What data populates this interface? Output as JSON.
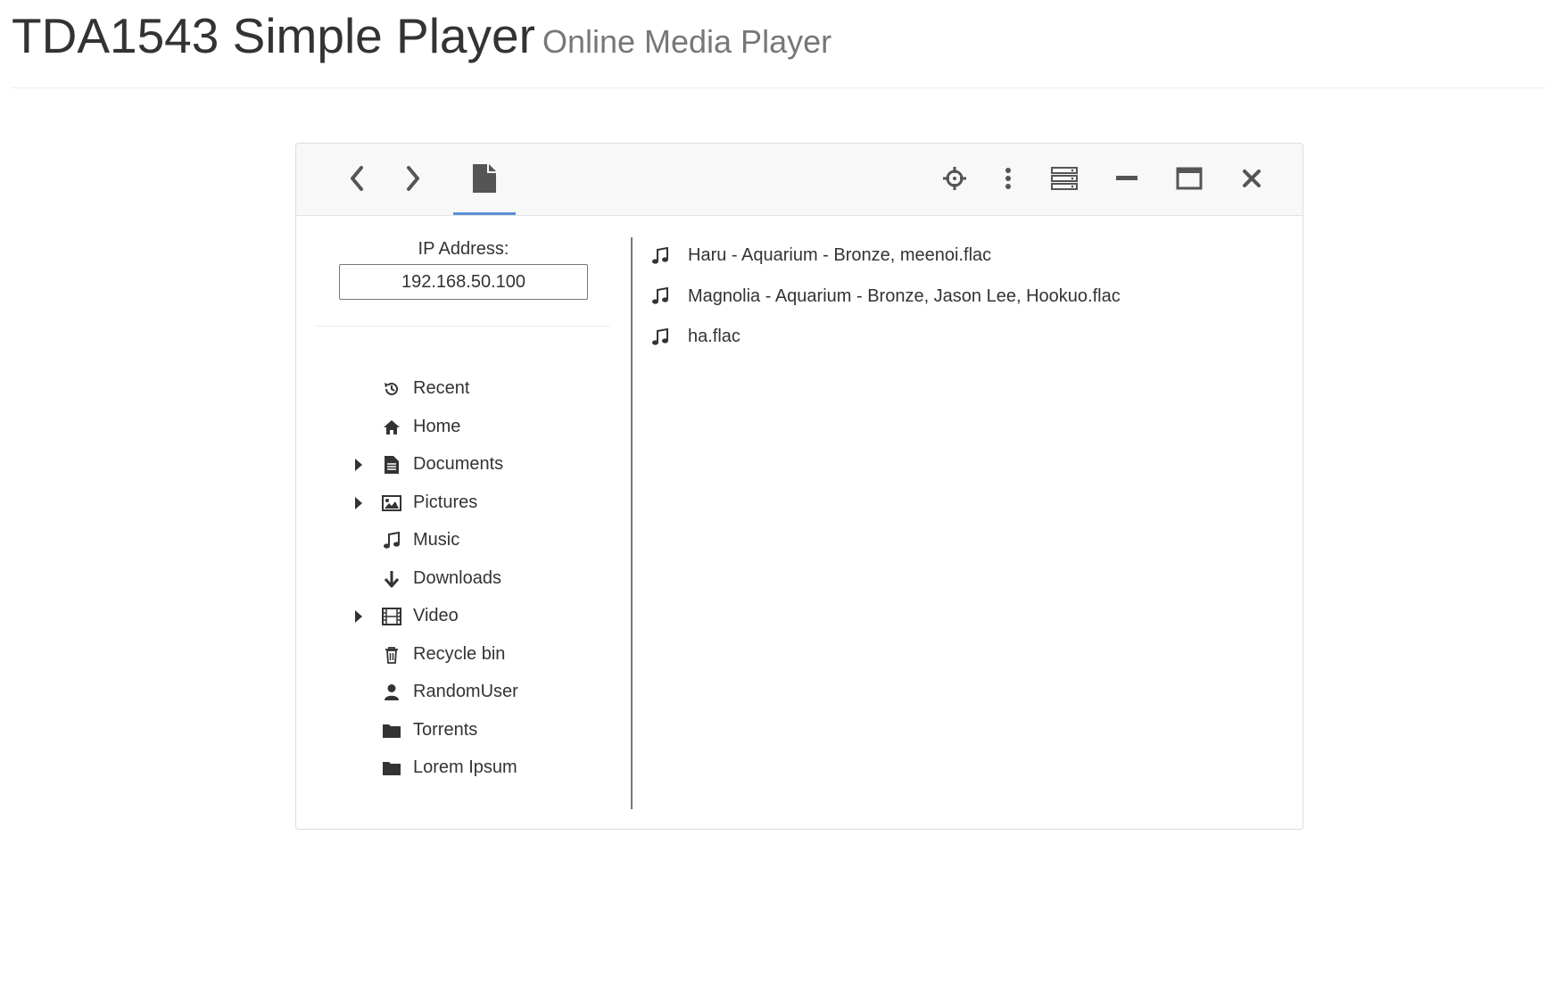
{
  "header": {
    "title": "TDA1543 Simple Player",
    "subtitle": "Online Media Player"
  },
  "toolbar": {
    "left": [
      {
        "icon": "chevron-left-icon"
      },
      {
        "icon": "chevron-right-icon"
      },
      {
        "icon": "file-icon",
        "active": true
      }
    ],
    "right": [
      {
        "icon": "crosshairs-icon"
      },
      {
        "icon": "vertical-ellipsis-icon"
      },
      {
        "icon": "server-icon"
      },
      {
        "icon": "minimize-icon"
      },
      {
        "icon": "maximize-icon"
      },
      {
        "icon": "close-icon"
      }
    ],
    "accent": "#5b8fd6"
  },
  "sidebar": {
    "ip_label": "IP Address:",
    "ip_value": "192.168.50.100",
    "items": [
      {
        "label": "Recent",
        "icon": "history-icon",
        "expandable": false
      },
      {
        "label": "Home",
        "icon": "home-icon",
        "expandable": false
      },
      {
        "label": "Documents",
        "icon": "document-icon",
        "expandable": true
      },
      {
        "label": "Pictures",
        "icon": "picture-icon",
        "expandable": true
      },
      {
        "label": "Music",
        "icon": "music-icon",
        "expandable": false
      },
      {
        "label": "Downloads",
        "icon": "arrow-down-icon",
        "expandable": false
      },
      {
        "label": "Video",
        "icon": "film-icon",
        "expandable": true
      },
      {
        "label": "Recycle bin",
        "icon": "trash-icon",
        "expandable": false
      },
      {
        "label": "RandomUser",
        "icon": "user-icon",
        "expandable": false
      },
      {
        "label": "Torrents",
        "icon": "folder-icon",
        "expandable": false
      },
      {
        "label": "Lorem Ipsum",
        "icon": "folder-icon",
        "expandable": false
      }
    ]
  },
  "files": [
    {
      "name": "Haru - Aquarium - Bronze, meenoi.flac",
      "icon": "music-icon"
    },
    {
      "name": "Magnolia - Aquarium - Bronze, Jason Lee, Hookuo.flac",
      "icon": "music-icon"
    },
    {
      "name": "ha.flac",
      "icon": "music-icon"
    }
  ]
}
